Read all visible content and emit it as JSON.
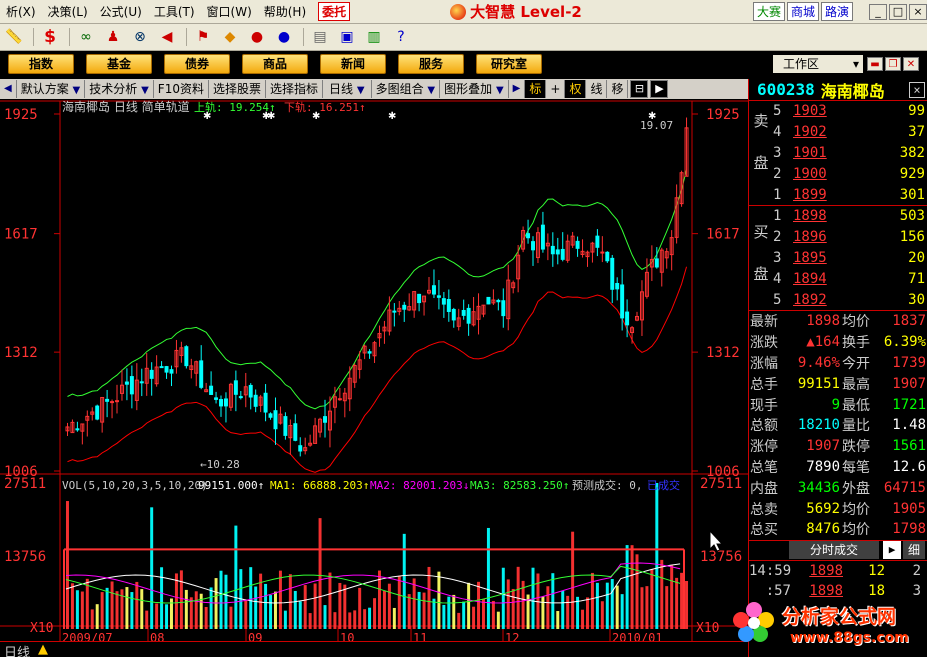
{
  "menu": {
    "items": [
      "析(X)",
      "决策(L)",
      "公式(U)",
      "工具(T)",
      "窗口(W)",
      "帮助(H)"
    ],
    "entrust": "委托",
    "app_title": "大智慧 Level-2",
    "right_buttons": [
      "大赛",
      "商城",
      "路演"
    ],
    "window_buttons": [
      "_",
      "□",
      "×"
    ]
  },
  "toolbar": {
    "icons": [
      "ruler-icon",
      "dollar-icon",
      "glasses-icon",
      "people-icon",
      "binoculars-icon",
      "horn-icon",
      "alarm-icon",
      "diamond-icon",
      "coin-icon",
      "coin-blue-icon",
      "print-icon",
      "window-icon",
      "books-icon",
      "help-icon"
    ]
  },
  "funcbar": {
    "buttons": [
      "指数",
      "基金",
      "债券",
      "商品",
      "新闻",
      "服务",
      "研究室"
    ],
    "workarea": "工作区"
  },
  "chart_toolbar": {
    "items": [
      "默认方案",
      "技术分析",
      "F10资料",
      "选择股票",
      "选择指标",
      "日线",
      "多图组合",
      "图形叠加"
    ],
    "icon_buttons": [
      "标",
      "+",
      "权",
      "线",
      "移"
    ]
  },
  "stock": {
    "code": "600238",
    "name": "海南椰岛"
  },
  "chart_data": {
    "type": "candlestick",
    "title": "海南椰岛 日线 简单轨道",
    "indicator": {
      "upper_label": "上轨: 19.254↑",
      "lower_label": "下轨: 16.251↑"
    },
    "price_axis": {
      "ticks": [
        1925,
        1617,
        1312,
        1006
      ],
      "range": [
        1006,
        1925
      ]
    },
    "annotations": {
      "high": "19.07",
      "low": "10.28"
    },
    "x_labels": [
      "2009/07",
      "08",
      "09",
      "10",
      "11",
      "12",
      "2010/01"
    ],
    "volume": {
      "legend": "VOL(5,10,20,3,5,10,20)",
      "vol_value": "99151.000↑",
      "ma1": "MA1: 66888.203↑",
      "ma2": "MA2: 82001.203↓",
      "ma3": "MA3: 82583.250↑",
      "forecast": "预测成交: 0,",
      "done": "已成交",
      "axis_ticks": [
        27511,
        13756
      ],
      "multiplier": "X10",
      "range": [
        0,
        27511
      ],
      "ref_line": 15000
    },
    "colors": {
      "up": "#ff3333",
      "down": "#00ffff",
      "upper_band": "#33ff33",
      "lower_band": "#ff0000",
      "ma1": "#ffffff",
      "ma2": "#ff00ff",
      "ma3": "#33ff33"
    }
  },
  "order_book": {
    "sell_label": [
      "卖",
      "盘"
    ],
    "buy_label": [
      "买",
      "盘"
    ],
    "sell": [
      {
        "level": "5",
        "price": "1903",
        "vol": "99"
      },
      {
        "level": "4",
        "price": "1902",
        "vol": "37"
      },
      {
        "level": "3",
        "price": "1901",
        "vol": "382"
      },
      {
        "level": "2",
        "price": "1900",
        "vol": "929"
      },
      {
        "level": "1",
        "price": "1899",
        "vol": "301"
      }
    ],
    "buy": [
      {
        "level": "1",
        "price": "1898",
        "vol": "503"
      },
      {
        "level": "2",
        "price": "1896",
        "vol": "156"
      },
      {
        "level": "3",
        "price": "1895",
        "vol": "20"
      },
      {
        "level": "4",
        "price": "1894",
        "vol": "71"
      },
      {
        "level": "5",
        "price": "1892",
        "vol": "30"
      }
    ]
  },
  "stats": [
    {
      "l1": "最新",
      "v1": "1898",
      "c1": "red",
      "l2": "均价",
      "v2": "1837",
      "c2": "red"
    },
    {
      "l1": "涨跌",
      "v1": "▲164",
      "c1": "red",
      "l2": "换手",
      "v2": "6.39%",
      "c2": "yel"
    },
    {
      "l1": "涨幅",
      "v1": "9.46%",
      "c1": "red",
      "l2": "今开",
      "v2": "1739",
      "c2": "red"
    },
    {
      "l1": "总手",
      "v1": "99151",
      "c1": "yel",
      "l2": "最高",
      "v2": "1907",
      "c2": "red"
    },
    {
      "l1": "现手",
      "v1": "9",
      "c1": "grn",
      "l2": "最低",
      "v2": "1721",
      "c2": "grn"
    },
    {
      "l1": "总额",
      "v1": "18210",
      "c1": "cyn",
      "l2": "量比",
      "v2": "1.48",
      "c2": "wht"
    },
    {
      "l1": "涨停",
      "v1": "1907",
      "c1": "red",
      "l2": "跌停",
      "v2": "1561",
      "c2": "grn"
    },
    {
      "l1": "总笔",
      "v1": "7890",
      "c1": "wht",
      "l2": "每笔",
      "v2": "12.6",
      "c2": "wht"
    },
    {
      "l1": "内盘",
      "v1": "34436",
      "c1": "grn",
      "l2": "外盘",
      "v2": "64715",
      "c2": "red"
    },
    {
      "l1": "总卖",
      "v1": "5692",
      "c1": "yel",
      "l2": "均价",
      "v2": "1905",
      "c2": "red"
    },
    {
      "l1": "总买",
      "v1": "8476",
      "c1": "yel",
      "l2": "均价",
      "v2": "1798",
      "c2": "red"
    }
  ],
  "ticks_panel": {
    "tab": "分时成交",
    "tab2": "细",
    "rows": [
      {
        "time": "14:59",
        "price": "1898",
        "vol": "12",
        "n": "2"
      },
      {
        "time": ":57",
        "price": "1898",
        "vol": "18",
        "n": "3"
      }
    ]
  },
  "brand": {
    "name": "分析家公式网",
    "url": "www.88gs.com"
  },
  "bottom": {
    "period": "日线"
  }
}
